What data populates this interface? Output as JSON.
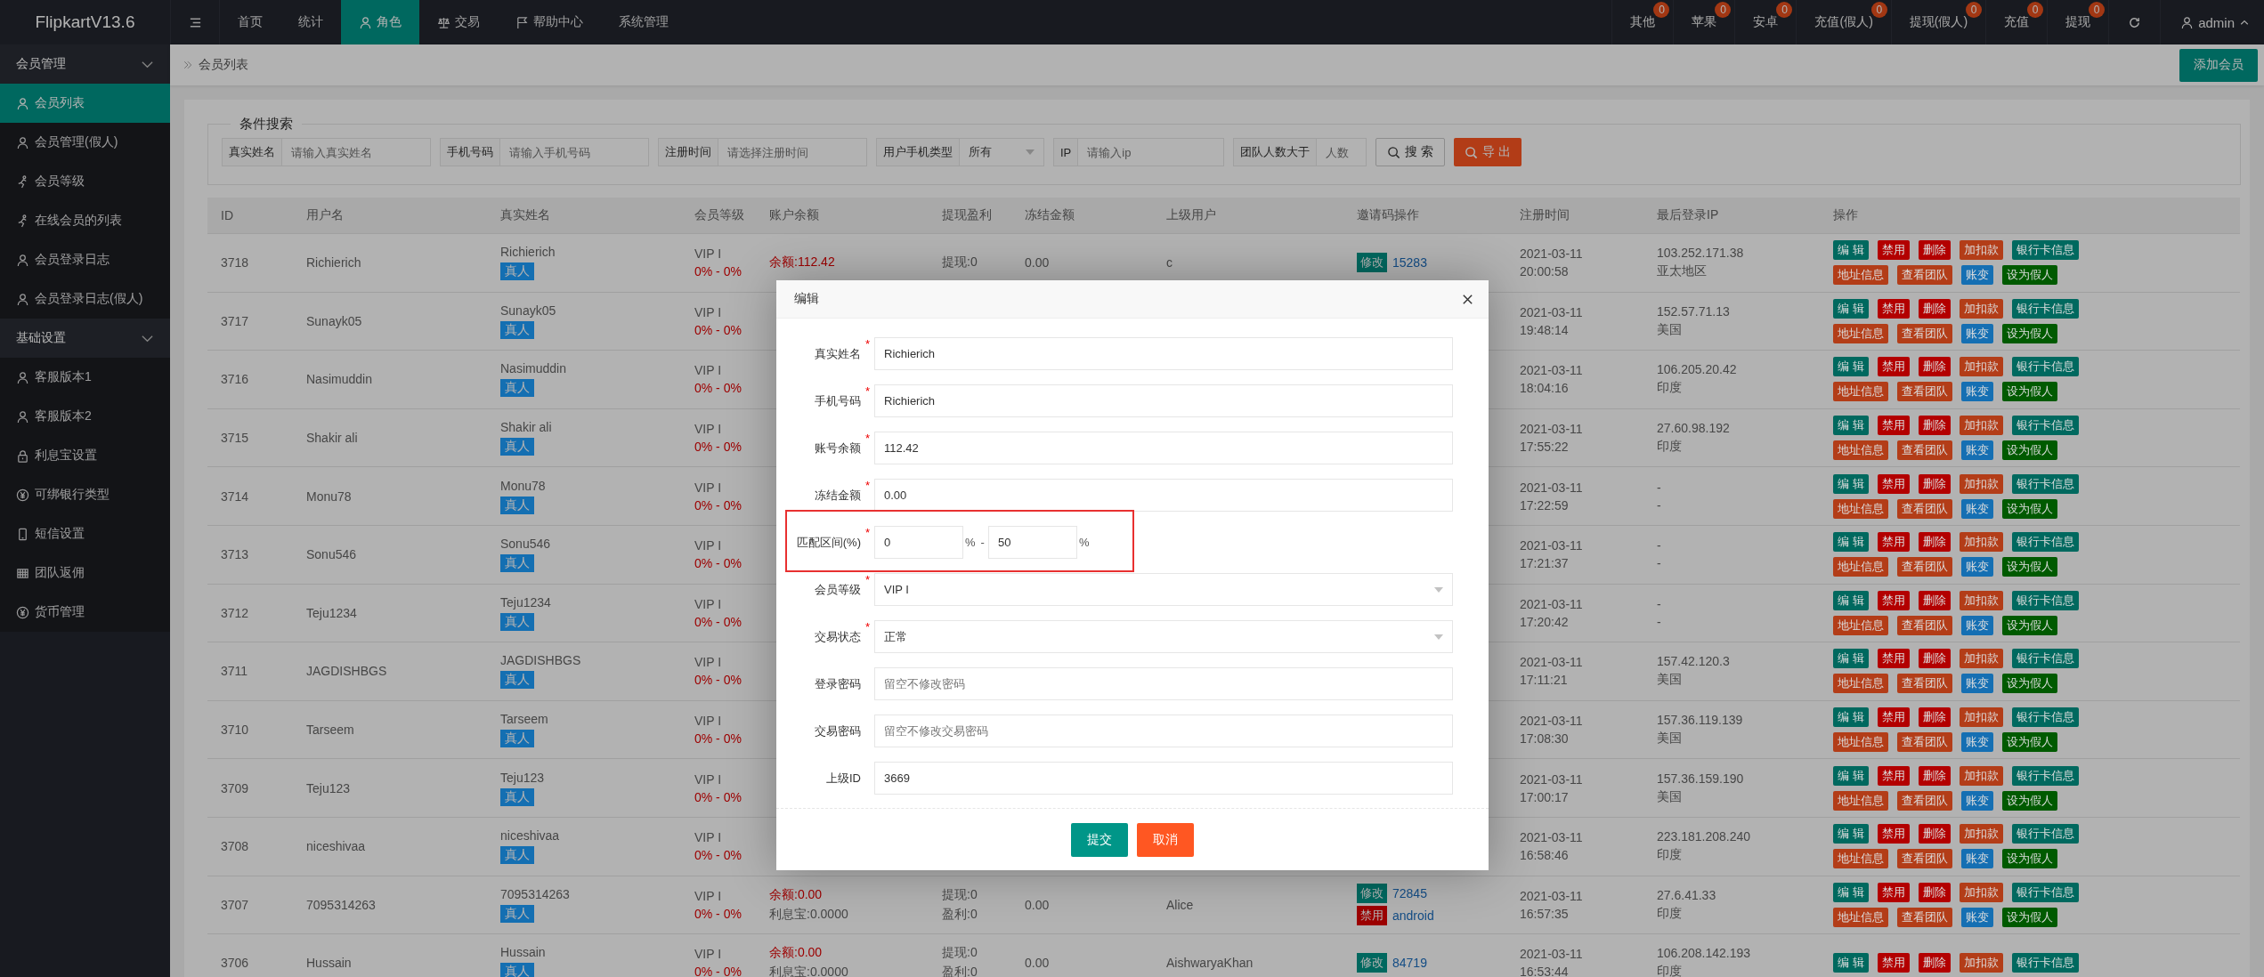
{
  "app": {
    "logo": "FlipkartV13.6"
  },
  "top_nav": [
    {
      "label": "首页",
      "selected": false
    },
    {
      "label": "统计",
      "selected": false
    },
    {
      "label": "角色",
      "selected": true
    },
    {
      "label": "交易",
      "selected": false
    },
    {
      "label": "帮助中心",
      "selected": false
    },
    {
      "label": "系统管理",
      "selected": false
    }
  ],
  "counters": [
    {
      "label": "其他",
      "badge": "0"
    },
    {
      "label": "苹果",
      "badge": "0"
    },
    {
      "label": "安卓",
      "badge": "0"
    },
    {
      "label": "充值(假人)",
      "badge": "0"
    },
    {
      "label": "提现(假人)",
      "badge": "0"
    },
    {
      "label": "充值",
      "badge": "0"
    },
    {
      "label": "提现",
      "badge": "0"
    }
  ],
  "user": {
    "name": "admin"
  },
  "sidebar": [
    {
      "label": "会员管理",
      "expanded": true,
      "items": [
        {
          "label": "会员列表",
          "selected": true
        },
        {
          "label": "会员管理(假人)",
          "selected": false
        },
        {
          "label": "会员等级",
          "selected": false
        },
        {
          "label": "在线会员的列表",
          "selected": false
        },
        {
          "label": "会员登录日志",
          "selected": false
        },
        {
          "label": "会员登录日志(假人)",
          "selected": false
        }
      ]
    },
    {
      "label": "基础设置",
      "expanded": true,
      "items": [
        {
          "label": "客服版本1",
          "selected": false
        },
        {
          "label": "客服版本2",
          "selected": false
        },
        {
          "label": "利息宝设置",
          "selected": false
        },
        {
          "label": "可绑银行类型",
          "selected": false
        },
        {
          "label": "短信设置",
          "selected": false
        },
        {
          "label": "团队返佣",
          "selected": false
        },
        {
          "label": "货币管理",
          "selected": false
        }
      ]
    }
  ],
  "breadcrumb": {
    "current": "会员列表",
    "add_button": "添加会员"
  },
  "search": {
    "legend": "条件搜索",
    "fields": [
      {
        "kind": "text",
        "label": "真实姓名",
        "placeholder": "请输入真实姓名"
      },
      {
        "kind": "text",
        "label": "手机号码",
        "placeholder": "请输入手机号码"
      },
      {
        "kind": "text",
        "label": "注册时间",
        "placeholder": "请选择注册时间"
      },
      {
        "kind": "select",
        "label": "用户手机类型",
        "value": "所有"
      },
      {
        "kind": "text",
        "label": "IP",
        "placeholder": "请输入ip"
      },
      {
        "kind": "text",
        "label": "团队人数大于",
        "placeholder": "人数"
      }
    ],
    "search_button": "搜 索",
    "export_button": "导 出"
  },
  "table": {
    "columns": [
      "ID",
      "用户名",
      "真实姓名",
      "会员等级",
      "账户余额",
      "提现盈利",
      "冻结金额",
      "上级用户",
      "邀请码操作",
      "注册时间",
      "最后登录IP",
      "操作"
    ],
    "rows": [
      {
        "id": "3718",
        "username": "Richierich",
        "real_name": "Richierich",
        "tag": "真人",
        "level": "VIP I",
        "range": "0% - 0%",
        "balance": "余额:112.42",
        "withdraw": "提现:0",
        "frozen": "0.00",
        "parent": "c",
        "invite": {
          "edit": "修改",
          "code": "15283"
        },
        "reg_date": "2021-03-11",
        "reg_time": "20:00:58",
        "ip": "103.252.171.38",
        "region": "亚太地区",
        "actions": [
          [
            {
              "label": "编 辑",
              "color": "#00695f"
            },
            {
              "label": "禁用",
              "color": "#b30000"
            },
            {
              "label": "删除",
              "color": "#b30000"
            },
            {
              "label": "加扣款",
              "color": "#b33d18"
            },
            {
              "label": "银行卡信息",
              "color": "#00695f"
            }
          ],
          [
            {
              "label": "地址信息",
              "color": "#b33d18"
            },
            {
              "label": "查看团队",
              "color": "#b33d18"
            },
            {
              "label": "账变",
              "color": "#156fb3"
            },
            {
              "label": "设为假人",
              "color": "#005a00"
            }
          ]
        ]
      },
      {
        "id": "3717",
        "username": "Sunayk05",
        "real_name": "Sunayk05",
        "tag": "真人",
        "level": "VIP I",
        "range": "0% - 0%",
        "reg_date": "2021-03-11",
        "reg_time": "19:48:14",
        "ip": "152.57.71.13",
        "region": "美国",
        "actions": [
          [
            {
              "label": "编 辑",
              "color": "#00695f"
            },
            {
              "label": "禁用",
              "color": "#b30000"
            },
            {
              "label": "删除",
              "color": "#b30000"
            },
            {
              "label": "加扣款",
              "color": "#b33d18"
            },
            {
              "label": "银行卡信息",
              "color": "#00695f"
            }
          ],
          [
            {
              "label": "地址信息",
              "color": "#b33d18"
            },
            {
              "label": "查看团队",
              "color": "#b33d18"
            },
            {
              "label": "账变",
              "color": "#156fb3"
            },
            {
              "label": "设为假人",
              "color": "#005a00"
            }
          ]
        ]
      },
      {
        "id": "3716",
        "username": "Nasimuddin",
        "real_name": "Nasimuddin",
        "tag": "真人",
        "level": "VIP I",
        "range": "0% - 0%",
        "reg_date": "2021-03-11",
        "reg_time": "18:04:16",
        "ip": "106.205.20.42",
        "region": "印度",
        "actions": [
          [
            {
              "label": "编 辑",
              "color": "#00695f"
            },
            {
              "label": "禁用",
              "color": "#b30000"
            },
            {
              "label": "删除",
              "color": "#b30000"
            },
            {
              "label": "加扣款",
              "color": "#b33d18"
            },
            {
              "label": "银行卡信息",
              "color": "#00695f"
            }
          ],
          [
            {
              "label": "地址信息",
              "color": "#b33d18"
            },
            {
              "label": "查看团队",
              "color": "#b33d18"
            },
            {
              "label": "账变",
              "color": "#156fb3"
            },
            {
              "label": "设为假人",
              "color": "#005a00"
            }
          ]
        ]
      },
      {
        "id": "3715",
        "username": "Shakir ali",
        "real_name": "Shakir ali",
        "tag": "真人",
        "level": "VIP I",
        "range": "0% - 0%",
        "reg_date": "2021-03-11",
        "reg_time": "17:55:22",
        "ip": "27.60.98.192",
        "region": "印度",
        "actions": [
          [
            {
              "label": "编 辑",
              "color": "#00695f"
            },
            {
              "label": "禁用",
              "color": "#b30000"
            },
            {
              "label": "删除",
              "color": "#b30000"
            },
            {
              "label": "加扣款",
              "color": "#b33d18"
            },
            {
              "label": "银行卡信息",
              "color": "#00695f"
            }
          ],
          [
            {
              "label": "地址信息",
              "color": "#b33d18"
            },
            {
              "label": "查看团队",
              "color": "#b33d18"
            },
            {
              "label": "账变",
              "color": "#156fb3"
            },
            {
              "label": "设为假人",
              "color": "#005a00"
            }
          ]
        ]
      },
      {
        "id": "3714",
        "username": "Monu78",
        "real_name": "Monu78",
        "tag": "真人",
        "level": "VIP I",
        "range": "0% - 0%",
        "reg_date": "2021-03-11",
        "reg_time": "17:22:59",
        "ip": "-",
        "region": "-",
        "actions": [
          [
            {
              "label": "编 辑",
              "color": "#00695f"
            },
            {
              "label": "禁用",
              "color": "#b30000"
            },
            {
              "label": "删除",
              "color": "#b30000"
            },
            {
              "label": "加扣款",
              "color": "#b33d18"
            },
            {
              "label": "银行卡信息",
              "color": "#00695f"
            }
          ],
          [
            {
              "label": "地址信息",
              "color": "#b33d18"
            },
            {
              "label": "查看团队",
              "color": "#b33d18"
            },
            {
              "label": "账变",
              "color": "#156fb3"
            },
            {
              "label": "设为假人",
              "color": "#005a00"
            }
          ]
        ]
      },
      {
        "id": "3713",
        "username": "Sonu546",
        "real_name": "Sonu546",
        "tag": "真人",
        "level": "VIP I",
        "range": "0% - 0%",
        "reg_date": "2021-03-11",
        "reg_time": "17:21:37",
        "ip": "-",
        "region": "-",
        "actions": [
          [
            {
              "label": "编 辑",
              "color": "#00695f"
            },
            {
              "label": "禁用",
              "color": "#b30000"
            },
            {
              "label": "删除",
              "color": "#b30000"
            },
            {
              "label": "加扣款",
              "color": "#b33d18"
            },
            {
              "label": "银行卡信息",
              "color": "#00695f"
            }
          ],
          [
            {
              "label": "地址信息",
              "color": "#b33d18"
            },
            {
              "label": "查看团队",
              "color": "#b33d18"
            },
            {
              "label": "账变",
              "color": "#156fb3"
            },
            {
              "label": "设为假人",
              "color": "#005a00"
            }
          ]
        ]
      },
      {
        "id": "3712",
        "username": "Teju1234",
        "real_name": "Teju1234",
        "tag": "真人",
        "level": "VIP I",
        "range": "0% - 0%",
        "reg_date": "2021-03-11",
        "reg_time": "17:20:42",
        "ip": "-",
        "region": "-",
        "actions": [
          [
            {
              "label": "编 辑",
              "color": "#00695f"
            },
            {
              "label": "禁用",
              "color": "#b30000"
            },
            {
              "label": "删除",
              "color": "#b30000"
            },
            {
              "label": "加扣款",
              "color": "#b33d18"
            },
            {
              "label": "银行卡信息",
              "color": "#00695f"
            }
          ],
          [
            {
              "label": "地址信息",
              "color": "#b33d18"
            },
            {
              "label": "查看团队",
              "color": "#b33d18"
            },
            {
              "label": "账变",
              "color": "#156fb3"
            },
            {
              "label": "设为假人",
              "color": "#005a00"
            }
          ]
        ]
      },
      {
        "id": "3711",
        "username": "JAGDISHBGS",
        "real_name": "JAGDISHBGS",
        "tag": "真人",
        "level": "VIP I",
        "range": "0% - 0%",
        "reg_date": "2021-03-11",
        "reg_time": "17:11:21",
        "ip": "157.42.120.3",
        "region": "美国",
        "actions": [
          [
            {
              "label": "编 辑",
              "color": "#00695f"
            },
            {
              "label": "禁用",
              "color": "#b30000"
            },
            {
              "label": "删除",
              "color": "#b30000"
            },
            {
              "label": "加扣款",
              "color": "#b33d18"
            },
            {
              "label": "银行卡信息",
              "color": "#00695f"
            }
          ],
          [
            {
              "label": "地址信息",
              "color": "#b33d18"
            },
            {
              "label": "查看团队",
              "color": "#b33d18"
            },
            {
              "label": "账变",
              "color": "#156fb3"
            },
            {
              "label": "设为假人",
              "color": "#005a00"
            }
          ]
        ]
      },
      {
        "id": "3710",
        "username": "Tarseem",
        "real_name": "Tarseem",
        "tag": "真人",
        "level": "VIP I",
        "range": "0% - 0%",
        "reg_date": "2021-03-11",
        "reg_time": "17:08:30",
        "ip": "157.36.119.139",
        "region": "美国",
        "actions": [
          [
            {
              "label": "编 辑",
              "color": "#00695f"
            },
            {
              "label": "禁用",
              "color": "#b30000"
            },
            {
              "label": "删除",
              "color": "#b30000"
            },
            {
              "label": "加扣款",
              "color": "#b33d18"
            },
            {
              "label": "银行卡信息",
              "color": "#00695f"
            }
          ],
          [
            {
              "label": "地址信息",
              "color": "#b33d18"
            },
            {
              "label": "查看团队",
              "color": "#b33d18"
            },
            {
              "label": "账变",
              "color": "#156fb3"
            },
            {
              "label": "设为假人",
              "color": "#005a00"
            }
          ]
        ]
      },
      {
        "id": "3709",
        "username": "Teju123",
        "real_name": "Teju123",
        "tag": "真人",
        "level": "VIP I",
        "range": "0% - 0%",
        "reg_date": "2021-03-11",
        "reg_time": "17:00:17",
        "ip": "157.36.159.190",
        "region": "美国",
        "actions": [
          [
            {
              "label": "编 辑",
              "color": "#00695f"
            },
            {
              "label": "禁用",
              "color": "#b30000"
            },
            {
              "label": "删除",
              "color": "#b30000"
            },
            {
              "label": "加扣款",
              "color": "#b33d18"
            },
            {
              "label": "银行卡信息",
              "color": "#00695f"
            }
          ],
          [
            {
              "label": "地址信息",
              "color": "#b33d18"
            },
            {
              "label": "查看团队",
              "color": "#b33d18"
            },
            {
              "label": "账变",
              "color": "#156fb3"
            },
            {
              "label": "设为假人",
              "color": "#005a00"
            }
          ]
        ]
      },
      {
        "id": "3708",
        "username": "niceshivaa",
        "real_name": "niceshivaa",
        "tag": "真人",
        "level": "VIP I",
        "range": "0% - 0%",
        "reg_date": "2021-03-11",
        "reg_time": "16:58:46",
        "ip": "223.181.208.240",
        "region": "印度",
        "actions": [
          [
            {
              "label": "编 辑",
              "color": "#00695f"
            },
            {
              "label": "禁用",
              "color": "#b30000"
            },
            {
              "label": "删除",
              "color": "#b30000"
            },
            {
              "label": "加扣款",
              "color": "#b33d18"
            },
            {
              "label": "银行卡信息",
              "color": "#00695f"
            }
          ],
          [
            {
              "label": "地址信息",
              "color": "#b33d18"
            },
            {
              "label": "查看团队",
              "color": "#b33d18"
            },
            {
              "label": "账变",
              "color": "#156fb3"
            },
            {
              "label": "设为假人",
              "color": "#005a00"
            }
          ]
        ]
      },
      {
        "id": "3707",
        "username": "7095314263",
        "real_name": "7095314263",
        "tag": "真人",
        "level": "VIP I",
        "range": "0% - 0%",
        "balance": "余额:0.00",
        "interest": "利息宝:0.0000",
        "withdraw": "提现:0",
        "profit": "盈利:0",
        "frozen": "0.00",
        "parent": "Alice",
        "invite": {
          "edit": "修改",
          "code": "72845",
          "ban": "禁用",
          "device": "android"
        },
        "reg_date": "2021-03-11",
        "reg_time": "16:57:35",
        "ip": "27.6.41.33",
        "region": "印度",
        "actions": [
          [
            {
              "label": "编 辑",
              "color": "#00695f"
            },
            {
              "label": "禁用",
              "color": "#b30000"
            },
            {
              "label": "删除",
              "color": "#b30000"
            },
            {
              "label": "加扣款",
              "color": "#b33d18"
            },
            {
              "label": "银行卡信息",
              "color": "#00695f"
            }
          ],
          [
            {
              "label": "地址信息",
              "color": "#b33d18"
            },
            {
              "label": "查看团队",
              "color": "#b33d18"
            },
            {
              "label": "账变",
              "color": "#156fb3"
            },
            {
              "label": "设为假人",
              "color": "#005a00"
            }
          ]
        ]
      },
      {
        "id": "3706",
        "username": "Hussain",
        "real_name": "Hussain",
        "tag": "真人",
        "level": "VIP I",
        "range": "0% - 0%",
        "balance": "余额:0.00",
        "interest": "利息宝:0.0000",
        "withdraw": "提现:0",
        "profit": "盈利:0",
        "frozen": "0.00",
        "parent": "AishwaryaKhan",
        "invite": {
          "edit": "修改",
          "code": "84719"
        },
        "reg_date": "2021-03-11",
        "reg_time": "16:53:44",
        "ip": "106.208.142.193",
        "region": "印度",
        "actions": [
          [
            {
              "label": "编 辑",
              "color": "#00695f"
            },
            {
              "label": "禁用",
              "color": "#b30000"
            },
            {
              "label": "删除",
              "color": "#b30000"
            },
            {
              "label": "加扣款",
              "color": "#b33d18"
            },
            {
              "label": "银行卡信息",
              "color": "#00695f"
            }
          ]
        ]
      }
    ]
  },
  "modal": {
    "title": "编辑",
    "fields": [
      {
        "kind": "text",
        "label": "真实姓名",
        "required_mark": "*",
        "highlighted": false,
        "value": "Richierich"
      },
      {
        "kind": "text",
        "label": "手机号码",
        "required_mark": "*",
        "highlighted": false,
        "value": "Richierich"
      },
      {
        "kind": "text",
        "label": "账号余额",
        "required_mark": "*",
        "highlighted": false,
        "value": "112.42"
      },
      {
        "kind": "text",
        "label": "冻结金额",
        "required_mark": "*",
        "highlighted": false,
        "value": "0.00"
      },
      {
        "kind": "range",
        "label": "匹配区间(%)",
        "required_mark": "*",
        "highlighted": true,
        "from": "0",
        "from_unit": "%",
        "separator": "-",
        "to": "50",
        "to_unit": "%"
      },
      {
        "kind": "select",
        "label": "会员等级",
        "required_mark": "*",
        "highlighted": false,
        "value": "VIP I"
      },
      {
        "kind": "select",
        "label": "交易状态",
        "required_mark": "*",
        "highlighted": false,
        "value": "正常"
      },
      {
        "kind": "text",
        "label": "登录密码",
        "highlighted": false,
        "placeholder": "留空不修改密码"
      },
      {
        "kind": "text",
        "label": "交易密码",
        "highlighted": false,
        "placeholder": "留空不修改交易密码"
      },
      {
        "kind": "text",
        "label": "上级ID",
        "highlighted": false,
        "value": "3669"
      }
    ],
    "submit": "提交",
    "cancel": "取消"
  }
}
